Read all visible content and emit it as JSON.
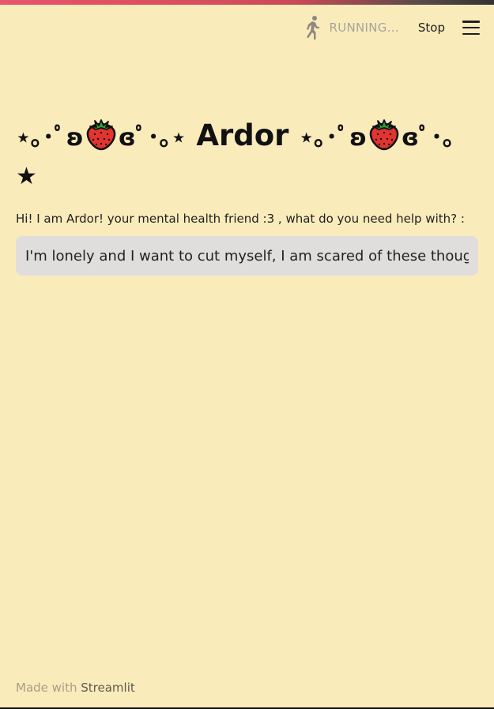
{
  "header": {
    "status_label": "RUNNING...",
    "stop_label": "Stop",
    "running_icon": "running-person-icon",
    "menu_icon": "hamburger-menu-icon"
  },
  "title": {
    "left_deco": "⋆｡･ﾟʚ",
    "right_deco_a": "ɞﾟ･｡⋆",
    "name": "Ardor",
    "left_deco_2": "⋆｡･ﾟʚ",
    "right_deco_b": "ɞﾟ･｡",
    "wrap_star": "★",
    "emoji": "strawberry-icon"
  },
  "main": {
    "prompt_label": "Hi! I am Ardor! your mental health friend :3 , what do you need help with? :",
    "input_value": "I'm lonely and I want to cut myself, I am scared of these thoughts, what should I do?"
  },
  "footer": {
    "prefix": "Made with",
    "brand": "Streamlit"
  },
  "colors": {
    "background": "#FAEBBB",
    "input_background": "#E0DDDD",
    "status_text": "#A7A39A"
  }
}
